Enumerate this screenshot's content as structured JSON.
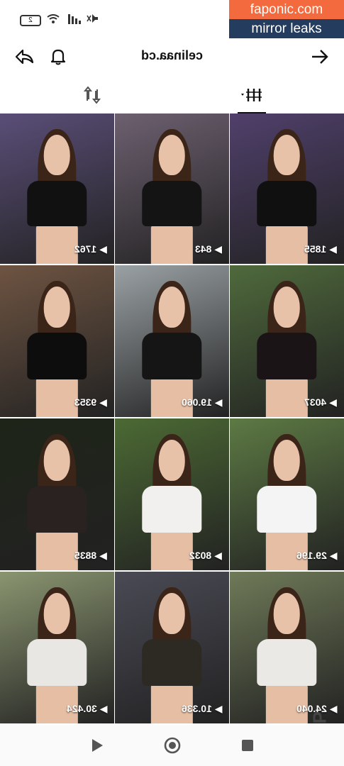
{
  "status_bar": {
    "battery_label": "2",
    "icons": [
      "battery-icon",
      "wifi-icon",
      "signal-icon",
      "mute-icon"
    ]
  },
  "watermark": {
    "line1": "faponic.com",
    "line2": "mirror leaks",
    "colors": {
      "line1_bg": "#f26a3d",
      "line2_bg": "#243d5e"
    }
  },
  "side_watermark": "DT.GIE.P",
  "header": {
    "title": "celinaa.cd",
    "left_icons": [
      "back-share-icon",
      "bell-icon"
    ],
    "right_icon": "arrow-right-icon"
  },
  "tabs": [
    {
      "name": "repost-tab",
      "icon": "repost-icon",
      "active": false
    },
    {
      "name": "videos-tab",
      "icon": "grid-bars-icon",
      "active": true
    }
  ],
  "grid": {
    "tiles": [
      {
        "count": "1762",
        "bg": "#5a4e78",
        "shirt": "#111111"
      },
      {
        "count": "843",
        "bg": "#6d6070",
        "shirt": "#141414"
      },
      {
        "count": "1855",
        "bg": "#50406c",
        "shirt": "#101010"
      },
      {
        "count": "9353",
        "bg": "#6e5442",
        "shirt": "#0d0d0d"
      },
      {
        "count": "19.060",
        "bg": "#9aa1a4",
        "shirt": "#151515"
      },
      {
        "count": "4037",
        "bg": "#4f6a3c",
        "shirt": "#1a1416"
      },
      {
        "count": "8835",
        "bg": "#1e2418",
        "shirt": "#2a2220"
      },
      {
        "count": "8032",
        "bg": "#4c6a34",
        "shirt": "#f2f0ee"
      },
      {
        "count": "29.196",
        "bg": "#5d7a44",
        "shirt": "#f4f4f4"
      },
      {
        "count": "30.424",
        "bg": "#8a9570",
        "shirt": "#e9e7e4"
      },
      {
        "count": "10.336",
        "bg": "#4a4a55",
        "shirt": "#2d2a24"
      },
      {
        "count": "24.040",
        "bg": "#6f7a58",
        "shirt": "#ebe9e6"
      }
    ]
  },
  "navbar": {
    "icons": [
      "play-icon",
      "home-circle-icon",
      "stop-square-icon"
    ]
  }
}
